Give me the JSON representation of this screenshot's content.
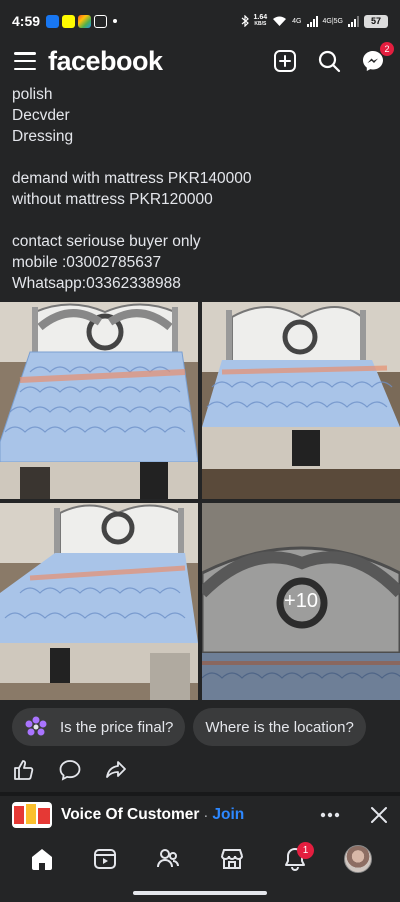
{
  "status_bar": {
    "time": "4:59",
    "net_speed_value": "1.64",
    "net_speed_unit": "KB/S",
    "network_4g": "4G",
    "network_4g5g": "4G|5G",
    "battery": "57"
  },
  "header": {
    "logo": "facebook",
    "messenger_badge": "2"
  },
  "post": {
    "lines": [
      "polish",
      "Decvder",
      "Dressing",
      "",
      "demand with mattress PKR140000",
      "without mattress PKR120000",
      "",
      "contact seriouse buyer only",
      "mobile  :03002785637",
      "Whatsapp:03362338988"
    ],
    "more_photos": "+10"
  },
  "quick_replies": [
    "Is the price final?",
    "Where is the location?"
  ],
  "suggestion": {
    "group_name": "Voice Of Customer",
    "separator": "·",
    "join_label": "Join"
  },
  "nav": {
    "notifications_badge": "1"
  },
  "colors": {
    "background": "#242526",
    "accent": "#2d88ff",
    "badge": "#e41e3f",
    "chip": "#3a3b3c"
  }
}
